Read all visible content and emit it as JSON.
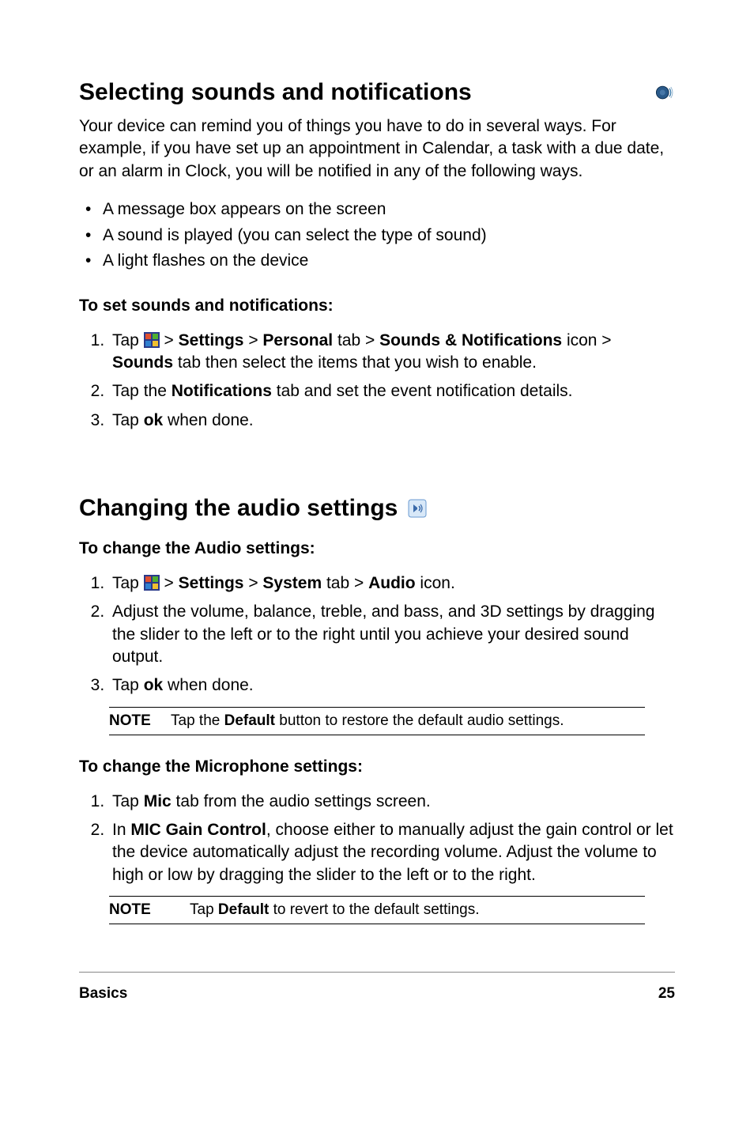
{
  "section1": {
    "title": "Selecting sounds and notifications",
    "intro": "Your device can remind you of things you have to do in several ways. For example, if you have set up an appointment in Calendar, a task with a due date, or an alarm in Clock, you will be notified in any of the following ways.",
    "bullets": [
      "A message box appears on the screen",
      "A sound is played (you can select the type of sound)",
      "A light flashes on the device"
    ],
    "subhead": "To set sounds and notifications:",
    "step1_pre": "Tap ",
    "step1_settings": "Settings",
    "step1_personal": "Personal",
    "step1_sounds_notif": "Sounds & Notifications",
    "step1_tab": " tab > ",
    "step1_icon": " icon > ",
    "step1_sounds": "Sounds",
    "step1_tail": " tab then select the items that you wish to enable.",
    "step2_pre": "Tap the ",
    "step2_notif": "Notifications",
    "step2_tail": " tab and set the event notification details.",
    "step3_pre": "Tap ",
    "step3_ok": "ok",
    "step3_tail": " when done."
  },
  "section2": {
    "title": "Changing the audio settings",
    "subhead": "To change the Audio settings:",
    "step1_pre": "Tap ",
    "step1_settings": "Settings",
    "step1_system": "System",
    "step1_tab": " tab > ",
    "step1_audio": "Audio",
    "step1_tail": " icon.",
    "step2": "Adjust the volume, balance, treble, and bass, and 3D settings by dragging the slider to the left or to the right until you achieve your desired sound output.",
    "step3_pre": "Tap ",
    "step3_ok": "ok",
    "step3_tail": " when done.",
    "note_label": "NOTE",
    "note_pre": "Tap the ",
    "note_default": "Default",
    "note_tail": " button to restore the default audio settings."
  },
  "section3": {
    "subhead": "To change the Microphone settings:",
    "step1_pre": "Tap ",
    "step1_mic": "Mic",
    "step1_tail": " tab from the audio settings screen.",
    "step2_pre": "In ",
    "step2_micgain": "MIC Gain Control",
    "step2_tail": ", choose either to manually adjust the gain control or let the device automatically adjust the recording volume. Adjust the volume to high or low by dragging the slider to the left or to the right.",
    "note_label": "NOTE",
    "note_pre": "Tap ",
    "note_default": "Default",
    "note_tail": " to revert to the default settings."
  },
  "footer": {
    "section": "Basics",
    "page": "25"
  },
  "glyphs": {
    "gt": " > "
  }
}
